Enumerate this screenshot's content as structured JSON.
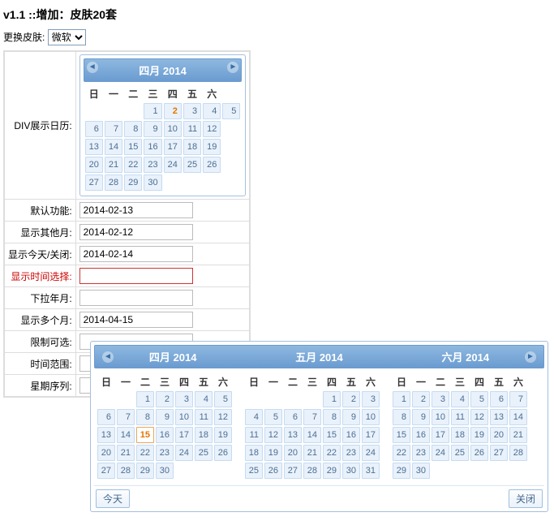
{
  "title": "v1.1 ::增加：皮肤20套",
  "skin": {
    "label": "更换皮肤:",
    "selected": "微软"
  },
  "rows": {
    "divCalendar": "DIV展示日历:",
    "defaultFunc": "默认功能:",
    "showOtherMonth": "显示其他月:",
    "showTodayClose": "显示今天/关闭:",
    "showTimeSelect": "显示时间选择:",
    "dropdownYM": "下拉年月:",
    "showMultiMonth": "显示多个月:",
    "limitSelectable": "限制可选:",
    "timeRange": "时间范围:",
    "weekSequence": "星期序列:"
  },
  "values": {
    "defaultFunc": "2014-02-13",
    "showOtherMonth": "2014-02-12",
    "showTodayClose": "2014-02-14",
    "showTimeSelect": "",
    "dropdownYM": "",
    "showMultiMonth": "2014-04-15",
    "limitSelectable": "",
    "timeRange": "",
    "weekSequence": ""
  },
  "weekdays": [
    "日",
    "一",
    "二",
    "三",
    "四",
    "五",
    "六"
  ],
  "cal1": {
    "title": "四月 2014",
    "todayDay": 2,
    "grid": [
      [
        "",
        "",
        "",
        1,
        2,
        3,
        4,
        5
      ],
      [
        6,
        7,
        8,
        9,
        10,
        11,
        12
      ],
      [
        13,
        14,
        15,
        16,
        17,
        18,
        19
      ],
      [
        20,
        21,
        22,
        23,
        24,
        25,
        26
      ],
      [
        27,
        28,
        29,
        30,
        "",
        "",
        ""
      ]
    ]
  },
  "multi": {
    "titles": [
      "四月 2014",
      "五月 2014",
      "六月 2014"
    ],
    "footer": {
      "today": "今天",
      "close": "关闭"
    },
    "months": [
      {
        "selected": 15,
        "grid": [
          [
            "",
            "",
            1,
            2,
            3,
            4,
            5
          ],
          [
            6,
            7,
            8,
            9,
            10,
            11,
            12
          ],
          [
            13,
            14,
            15,
            16,
            17,
            18,
            19
          ],
          [
            20,
            21,
            22,
            23,
            24,
            25,
            26
          ],
          [
            27,
            28,
            29,
            30,
            "",
            "",
            ""
          ]
        ]
      },
      {
        "grid": [
          [
            "",
            "",
            "",
            "",
            1,
            2,
            3
          ],
          [
            4,
            5,
            6,
            7,
            8,
            9,
            10
          ],
          [
            11,
            12,
            13,
            14,
            15,
            16,
            17
          ],
          [
            18,
            19,
            20,
            21,
            22,
            23,
            24
          ],
          [
            25,
            26,
            27,
            28,
            29,
            30,
            31
          ]
        ]
      },
      {
        "grid": [
          [
            1,
            2,
            3,
            4,
            5,
            6,
            7
          ],
          [
            8,
            9,
            10,
            11,
            12,
            13,
            14
          ],
          [
            15,
            16,
            17,
            18,
            19,
            20,
            21
          ],
          [
            22,
            23,
            24,
            25,
            26,
            27,
            28
          ],
          [
            29,
            30,
            "",
            "",
            "",
            "",
            ""
          ]
        ]
      }
    ]
  }
}
